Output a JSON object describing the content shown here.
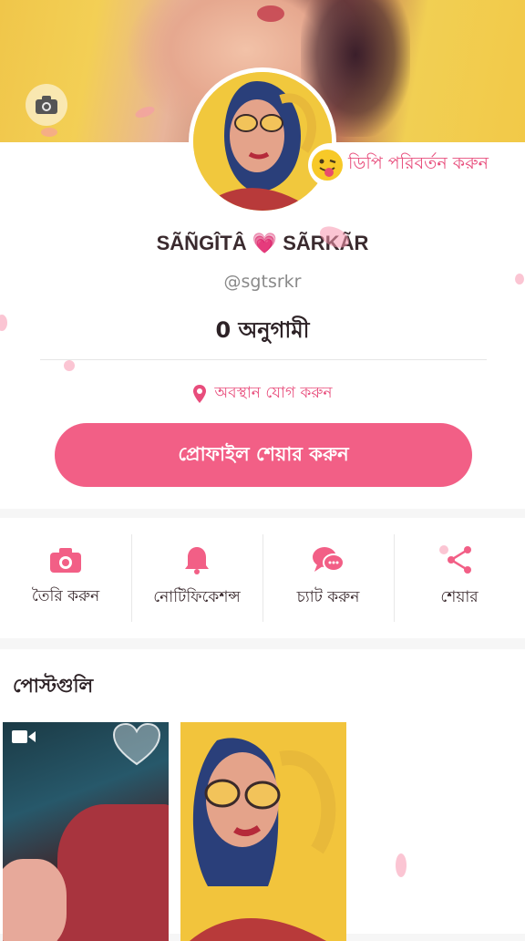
{
  "profile": {
    "name": "SÃÑGÎTÂ 💗 SÃRKÃR",
    "handle": "@sgtsrkr",
    "followers": "0 অনুগামী",
    "change_dp_label": "ডিপি পরিবর্তন করুন",
    "add_location_label": "অবস্থান যোগ করুন",
    "share_profile_label": "প্রোফাইল শেয়ার করুন"
  },
  "actions": [
    {
      "label": "তৈরি করুন",
      "icon": "camera-icon"
    },
    {
      "label": "নোটিফিকেশন্স",
      "icon": "bell-icon"
    },
    {
      "label": "চ্যাট করুন",
      "icon": "chat-icon"
    },
    {
      "label": "শেয়ার",
      "icon": "share-icon"
    }
  ],
  "posts": {
    "title": "পোস্টগুলি",
    "items": [
      {
        "type": "video",
        "icon": "video-camera-icon"
      },
      {
        "type": "image"
      }
    ]
  },
  "colors": {
    "accent": "#f25f86",
    "accent_text": "#e84d7c",
    "cover_yellow": "#f2c948"
  }
}
